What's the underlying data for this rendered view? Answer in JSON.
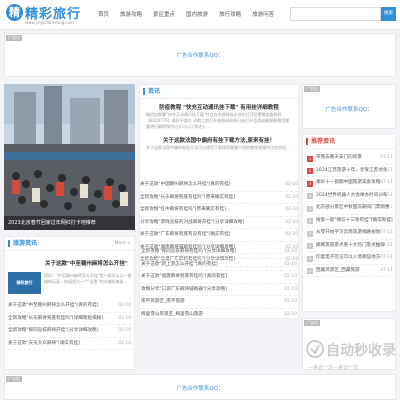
{
  "header": {
    "logo_mark": "精",
    "logo_title": "精彩旅行",
    "logo_sub": "www.jingcaitravling.com",
    "nav": [
      "首页",
      "旅游攻略",
      "景区重点",
      "国内旅游",
      "旅行攻略",
      "旅游问答"
    ],
    "search_placeholder": "",
    "search_button": "搜索"
  },
  "ads": {
    "tag": "广告位",
    "text": "广告合作联系QQ："
  },
  "slider": {
    "caption": "2023北京春节回家过年网红打卡地推荐"
  },
  "headlines": {
    "title": "资讯",
    "headline1": "防疫教程 \"快充互动通讯挂下载\" 有用挂详细教程",
    "summary1": "微信加群聊\"快充互动通讯挂下载\"并且在进群时候必须先打开设置微信收款码【8000776】最好不要在 进群之前打开收款码如果已经打开会造成被限制使用需要进行解除操作后才可以正常进入...",
    "headline2": "关于这款法国中偏府有挂下载方法,原来有挂！",
    "summary2": "关于这款法国中偏府有挂方法可以使用下载按照客服介绍的教程来操作比较合适...",
    "list": [
      {
        "t": "关于这款\"中国赣州麻将怎么开挂\"[真的有挂]",
        "d": "02-10"
      },
      {
        "t": "全新攻略\"长乐麻将到底有挂吗\"[原来确实有挂]",
        "d": "02-10"
      },
      {
        "t": "全新攻略\"红中麻将有挂吗\"[原来确实有挂]",
        "d": "02-10"
      },
      {
        "t": "分享攻略\"游戏竞技的对战麻将开挂\"[分享详细攻略]",
        "d": "02-10"
      },
      {
        "t": "关于这款\"广东麻将到底有没有挂\"[确实有挂]",
        "d": "02-10"
      },
      {
        "t": "关于这款\"湖南麻将辅助有挂吗\"[分享详细攻略]",
        "d": "02-10"
      },
      {
        "t": "全新攻略\"雀巢广东麻将有挂吗\"[分享详细攻略]",
        "d": "02-10"
      }
    ]
  },
  "right_ad": {
    "text": "广告合作联系QQ："
  },
  "recommend": {
    "title": "推荐资讯",
    "list": [
      {
        "t": "带我去看天安门的风景",
        "d": "07-11"
      },
      {
        "t": "2024江苏旅游十年，享受江苏文化",
        "d": "07-11"
      },
      {
        "t": "秦岭十一假期中国旅游美食攻略",
        "d": "07-11"
      },
      {
        "t": "2024世界机器人大会举办时间公布",
        "d": "07-11"
      },
      {
        "t": "北京部分景区中秋国庆期间门票优惠",
        "d": "07-11"
      },
      {
        "t": "搜索一款\"微信十三张有挂\"[确实有挂]",
        "d": "07-11"
      },
      {
        "t": "从零开始学习云南旅游线路规划",
        "d": "07-11"
      },
      {
        "t": "邯郸旅游景点看十大热门景点推荐",
        "d": "07-11"
      },
      {
        "t": "印度电子签证可以入境哪些地方",
        "d": "07-11"
      },
      {
        "t": "西藏风景区_西藏旅游",
        "d": "07-11"
      }
    ]
  },
  "news": {
    "title": "旅游资讯",
    "more": "More »",
    "headline": "关于这款\"中至赣州麻将怎么开挂\"",
    "thumb_text": "精彩旅行",
    "summary": "您好：\"中至赣州麻将怎么开挂\"是一款可以让一直输的玩家，快速成为一个\"必胜\"的ai辅助神器...",
    "list": [
      {
        "t": "关于这款\"中至赣州麻将怎么开挂\"[真的有挂]",
        "d": "02-10"
      },
      {
        "t": "全新攻略\"长乐麻将到底有挂吗\"[详细教程揭秘]",
        "d": "02-10"
      },
      {
        "t": "全新攻略\"探同竞技麻将开挂\"[分享详细攻略]",
        "d": "02-10"
      },
      {
        "t": "关于这款\"天天大众麻将\"[确实有挂]",
        "d": "02-10"
      }
    ]
  },
  "middle_list": [
    {
      "t": "全新攻略\"探同竞技麻将有挂吗\"[分享详细攻略]",
      "d": "02-10"
    },
    {
      "t": "关于这款\"新上游怎么开挂\"[真的有挂]",
      "d": "02-10"
    },
    {
      "t": "关于这款\"福建麻将到底有挂吗\"[真的有挂]",
      "d": "02-10"
    },
    {
      "t": "攻略分享\"口袋广东麻将辅助器\"[分享攻略]",
      "d": "02-10"
    },
    {
      "t": "南平风景区_南平旅游",
      "d": "02-10"
    },
    {
      "t": "梅里雪山风景区_梅里雪山旅游",
      "d": "02-10"
    }
  ],
  "watermark": {
    "main": "自动秒收录",
    "sub": "—来访一次—来访一次"
  }
}
